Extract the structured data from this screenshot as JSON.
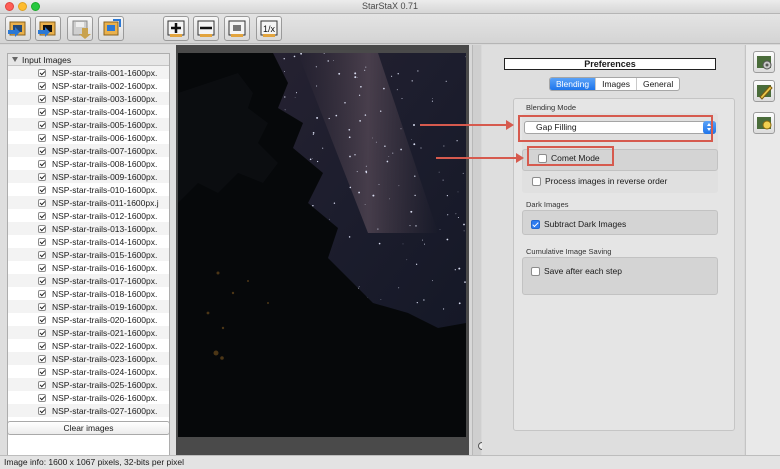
{
  "window": {
    "title": "StarStaX 0.71"
  },
  "toolbar": {
    "buttons": [
      "open-images-icon",
      "open-dark-images-icon",
      "save-icon",
      "save-as-icon",
      "start-blending-icon",
      "stop-icon",
      "blend-mode-icon",
      "help-icon"
    ]
  },
  "file_list": {
    "header": "Input Images",
    "items": [
      "NSP-star-trails-001-1600px.",
      "NSP-star-trails-002-1600px.",
      "NSP-star-trails-003-1600px.",
      "NSP-star-trails-004-1600px.",
      "NSP-star-trails-005-1600px.",
      "NSP-star-trails-006-1600px.",
      "NSP-star-trails-007-1600px.",
      "NSP-star-trails-008-1600px.",
      "NSP-star-trails-009-1600px.",
      "NSP-star-trails-010-1600px.",
      "NSP-star-trails-011-1600px.j",
      "NSP-star-trails-012-1600px.",
      "NSP-star-trails-013-1600px.",
      "NSP-star-trails-014-1600px.",
      "NSP-star-trails-015-1600px.",
      "NSP-star-trails-016-1600px.",
      "NSP-star-trails-017-1600px.",
      "NSP-star-trails-018-1600px.",
      "NSP-star-trails-019-1600px.",
      "NSP-star-trails-020-1600px.",
      "NSP-star-trails-021-1600px.",
      "NSP-star-trails-022-1600px.",
      "NSP-star-trails-023-1600px.",
      "NSP-star-trails-024-1600px.",
      "NSP-star-trails-025-1600px.",
      "NSP-star-trails-026-1600px.",
      "NSP-star-trails-027-1600px."
    ],
    "clear_label": "Clear images"
  },
  "preferences": {
    "title": "Preferences",
    "tabs": [
      "Blending",
      "Images",
      "General"
    ],
    "active_tab": "Blending",
    "blending_mode": {
      "label": "Blending Mode",
      "selected": "Gap Filling",
      "comet_mode_label": "Comet Mode",
      "comet_mode_checked": false,
      "reverse_label": "Process images in reverse order",
      "reverse_checked": false
    },
    "dark_images": {
      "label": "Dark Images",
      "subtract_label": "Subtract Dark Images",
      "subtract_checked": true
    },
    "cumulative": {
      "label": "Cumulative Image Saving",
      "save_label": "Save after each step",
      "save_checked": false
    }
  },
  "right_sidebar": {
    "buttons": [
      "preferences-icon",
      "edit-icon",
      "brightness-icon"
    ]
  },
  "status": {
    "text": "Image info: 1600 x 1067 pixels, 32-bits per pixel"
  },
  "colors": {
    "accent": "#1f75eb",
    "annotation": "#d65a4e"
  }
}
